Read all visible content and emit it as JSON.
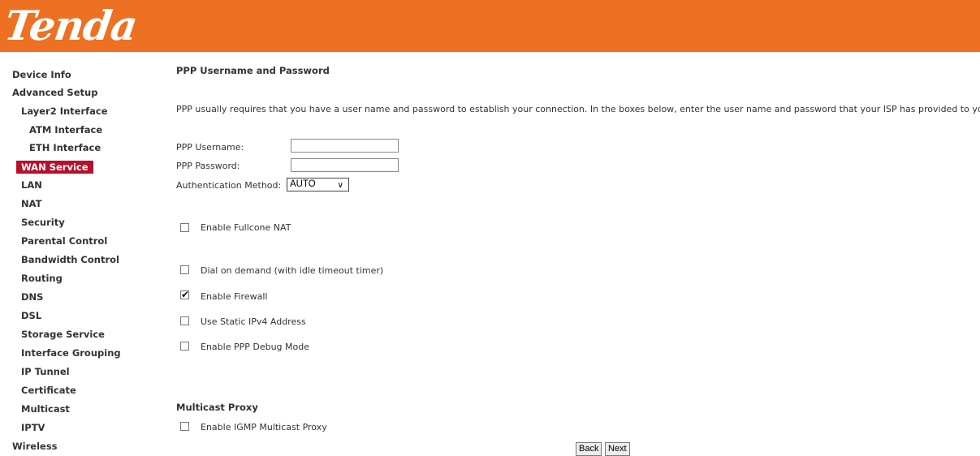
{
  "brand": {
    "logo_text": "Tenda",
    "header_color": "#ed7023",
    "active_color": "#b5112b"
  },
  "sidebar": {
    "items": [
      {
        "label": "Device Info"
      },
      {
        "label": "Advanced Setup"
      },
      {
        "label": "Layer2 Interface"
      },
      {
        "label": "ATM Interface"
      },
      {
        "label": "ETH Interface"
      },
      {
        "label": "WAN Service",
        "active": true
      },
      {
        "label": "LAN"
      },
      {
        "label": "NAT"
      },
      {
        "label": "Security"
      },
      {
        "label": "Parental Control"
      },
      {
        "label": "Bandwidth Control"
      },
      {
        "label": "Routing"
      },
      {
        "label": "DNS"
      },
      {
        "label": "DSL"
      },
      {
        "label": "Storage Service"
      },
      {
        "label": "Interface Grouping"
      },
      {
        "label": "IP Tunnel"
      },
      {
        "label": "Certificate"
      },
      {
        "label": "Multicast"
      },
      {
        "label": "IPTV"
      },
      {
        "label": "Wireless"
      }
    ]
  },
  "main": {
    "section_title": "PPP Username and Password",
    "description": "PPP usually requires that you have a user name and password to establish your connection. In the boxes below, enter the user name and password that your ISP has provided to you",
    "username_label": "PPP Username:",
    "username_value": "",
    "password_label": "PPP Password:",
    "password_value": "",
    "auth_label": "Authentication Method:",
    "auth_value": "AUTO",
    "checkboxes": {
      "fullcone": {
        "label": "Enable Fullcone NAT",
        "checked": false
      },
      "dial": {
        "label": "Dial on demand (with idle timeout timer)",
        "checked": false
      },
      "firewall": {
        "label": "Enable Firewall",
        "checked": true
      },
      "static_ip": {
        "label": "Use Static IPv4 Address",
        "checked": false
      },
      "debug": {
        "label": "Enable PPP Debug Mode",
        "checked": false
      },
      "igmp": {
        "label": "Enable IGMP Multicast Proxy",
        "checked": false
      }
    },
    "multicast_title": "Multicast Proxy",
    "back_label": "Back",
    "next_label": "Next"
  }
}
